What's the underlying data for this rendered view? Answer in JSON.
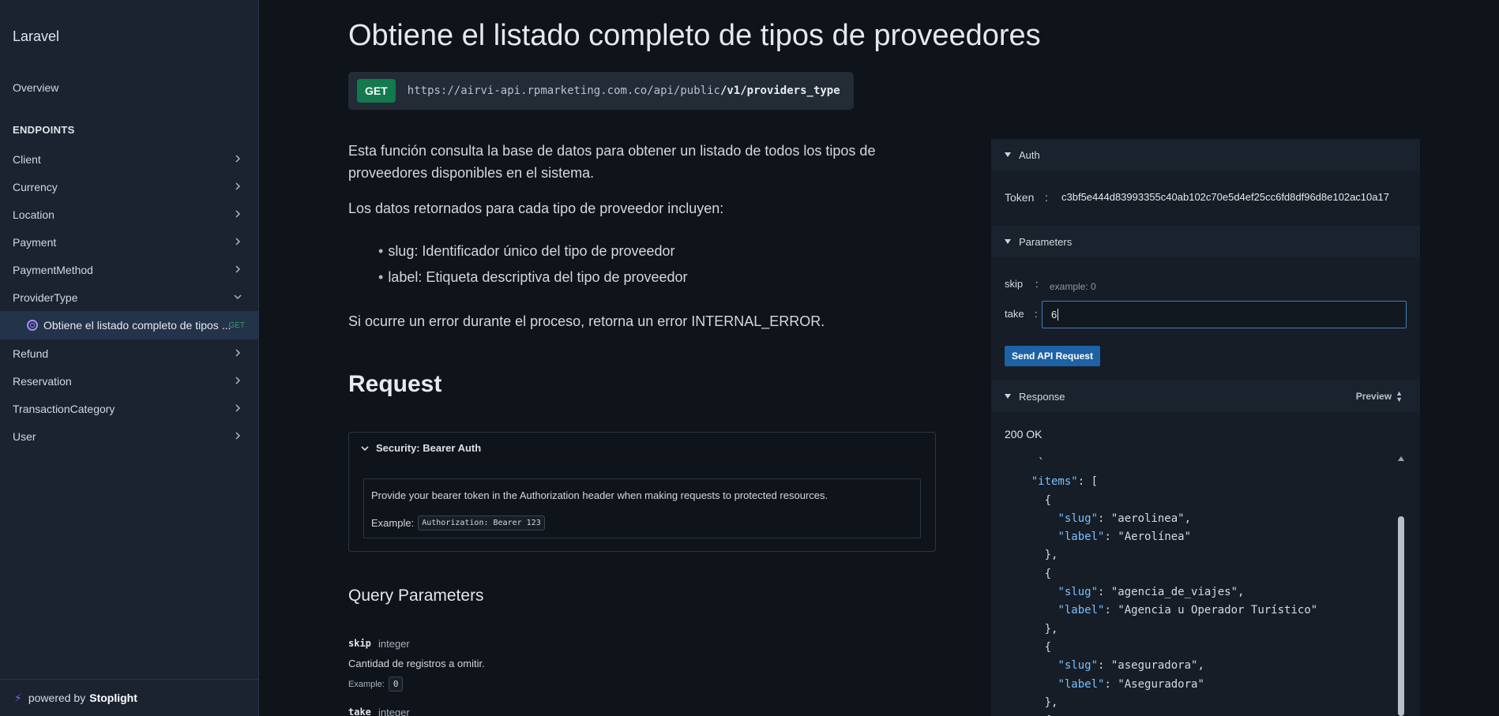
{
  "sidebar": {
    "brand": "Laravel",
    "overview": "Overview",
    "endpoints_heading": "ENDPOINTS",
    "items": [
      {
        "label": "Client"
      },
      {
        "label": "Currency"
      },
      {
        "label": "Location"
      },
      {
        "label": "Payment"
      },
      {
        "label": "PaymentMethod"
      },
      {
        "label": "ProviderType"
      },
      {
        "label": "Refund"
      },
      {
        "label": "Reservation"
      },
      {
        "label": "TransactionCategory"
      },
      {
        "label": "User"
      }
    ],
    "active_item": {
      "label": "Obtiene el listado completo de tipos ...",
      "method": "GET"
    },
    "powered_prefix": "powered by",
    "powered_brand": "Stoplight"
  },
  "main": {
    "title": "Obtiene el listado completo de tipos de proveedores",
    "method": "GET",
    "url_base": "https://airvi-api.rpmarketing.com.co/api/public",
    "url_path": "/v1/providers_type",
    "description": [
      "Esta función consulta la base de datos para obtener un listado de todos los tipos de",
      "proveedores disponibles en el sistema."
    ],
    "fields_intro": "Los datos retornados para cada tipo de proveedor incluyen:",
    "bullets": [
      "slug: Identificador único del tipo de proveedor",
      "label: Etiqueta descriptiva del tipo de proveedor"
    ],
    "error_note": "Si ocurre un error durante el proceso, retorna un error INTERNAL_ERROR.",
    "request_heading": "Request",
    "security": {
      "title": "Security: Bearer Auth",
      "description": "Provide your bearer token in the Authorization header when making requests to protected resources.",
      "example_label": "Example:",
      "example_value": "Authorization: Bearer 123"
    },
    "query_heading": "Query Parameters",
    "params": [
      {
        "name": "skip",
        "type": "integer",
        "description": "Cantidad de registros a omitir.",
        "example_label": "Example:",
        "example": "0"
      },
      {
        "name": "take",
        "type": "integer"
      }
    ]
  },
  "panel": {
    "auth_label": "Auth",
    "token_label": "Token",
    "token_value": "c3bf5e444d83993355c40ab102c70e5d4ef25cc6fd8df96d8e102ac10a17",
    "params_label": "Parameters",
    "skip_label": "skip",
    "skip_placeholder": "example: 0",
    "take_label": "take",
    "take_value": "6",
    "colon": ":",
    "send_label": "Send API Request",
    "response_label": "Response",
    "preview_label": "Preview",
    "status": "200 OK",
    "code_lines": [
      "     `",
      "    \"items\": [",
      "      {",
      "        \"slug\": \"aerolinea\",",
      "        \"label\": \"Aerolínea\"",
      "      },",
      "      {",
      "        \"slug\": \"agencia_de_viajes\",",
      "        \"label\": \"Agencia u Operador Turístico\"",
      "      },",
      "      {",
      "        \"slug\": \"aseguradora\",",
      "        \"label\": \"Aseguradora\"",
      "      },",
      "      {"
    ]
  },
  "colors": {
    "get_badge": "#127a4c",
    "accent": "#1d62a4",
    "purple": "#a78bfa"
  }
}
